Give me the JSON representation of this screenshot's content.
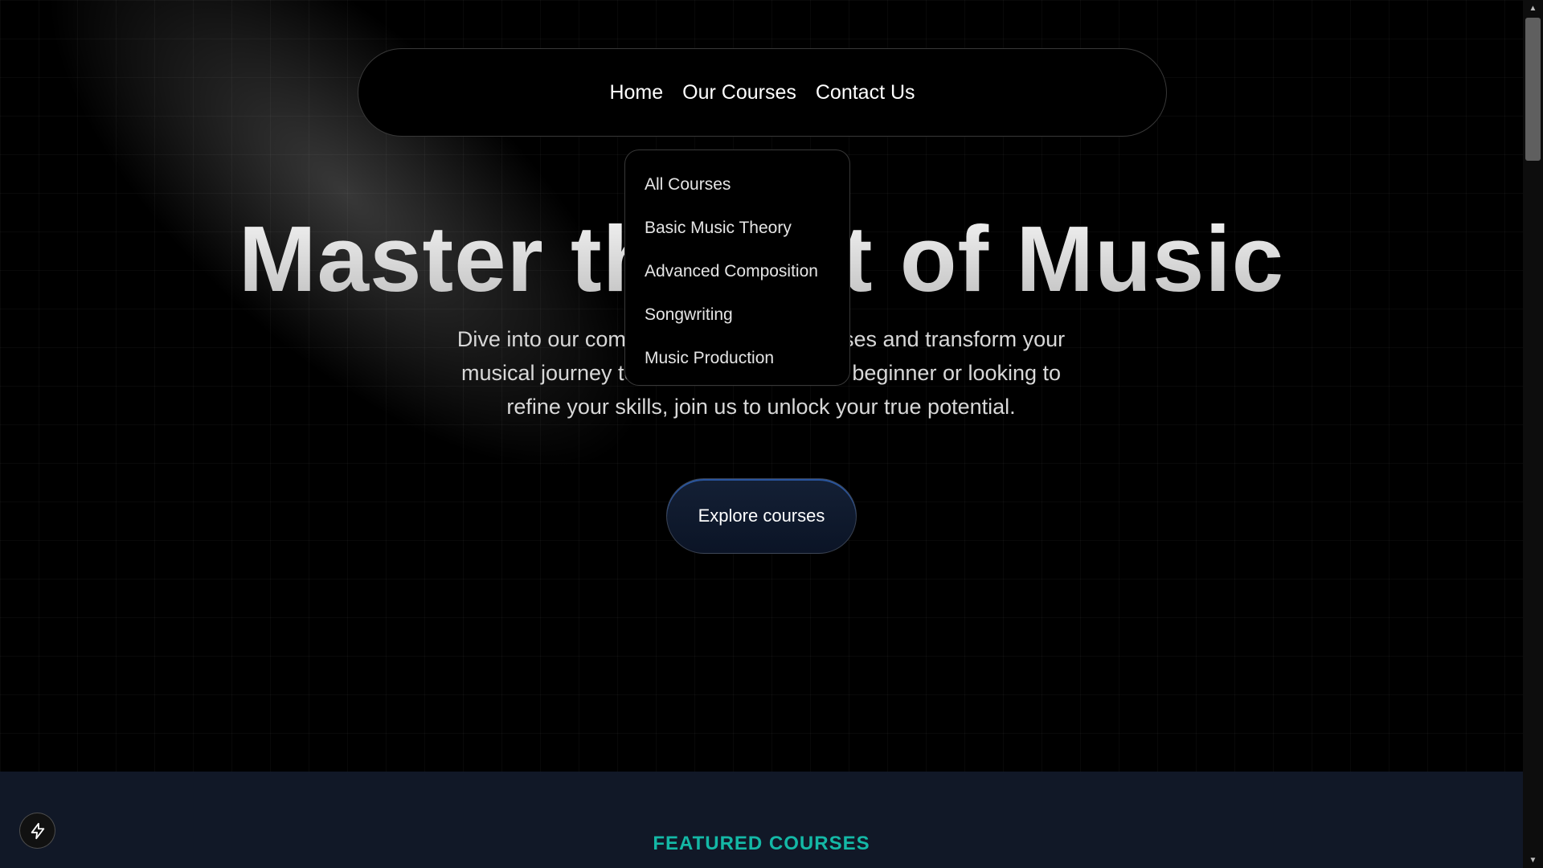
{
  "nav": {
    "home": "Home",
    "courses": "Our Courses",
    "contact": "Contact Us"
  },
  "dropdown": {
    "items": [
      {
        "label": "All Courses"
      },
      {
        "label": "Basic Music Theory"
      },
      {
        "label": "Advanced Composition"
      },
      {
        "label": "Songwriting"
      },
      {
        "label": "Music Production"
      }
    ]
  },
  "hero": {
    "title": "Master the Art of Music",
    "subtitle": "Dive into our comprehensive music courses and transform your musical journey today. Whether you're a beginner or looking to refine your skills, join us to unlock your true potential.",
    "cta": "Explore courses"
  },
  "featured": {
    "label": "FEATURED COURSES"
  },
  "colors": {
    "accent_teal": "#14b8a6",
    "section_bg": "#111827",
    "button_bg": "#142035"
  },
  "icons": {
    "floating_button": "bolt-icon",
    "scroll_up": "arrow-up-icon",
    "scroll_down": "arrow-down-icon"
  }
}
